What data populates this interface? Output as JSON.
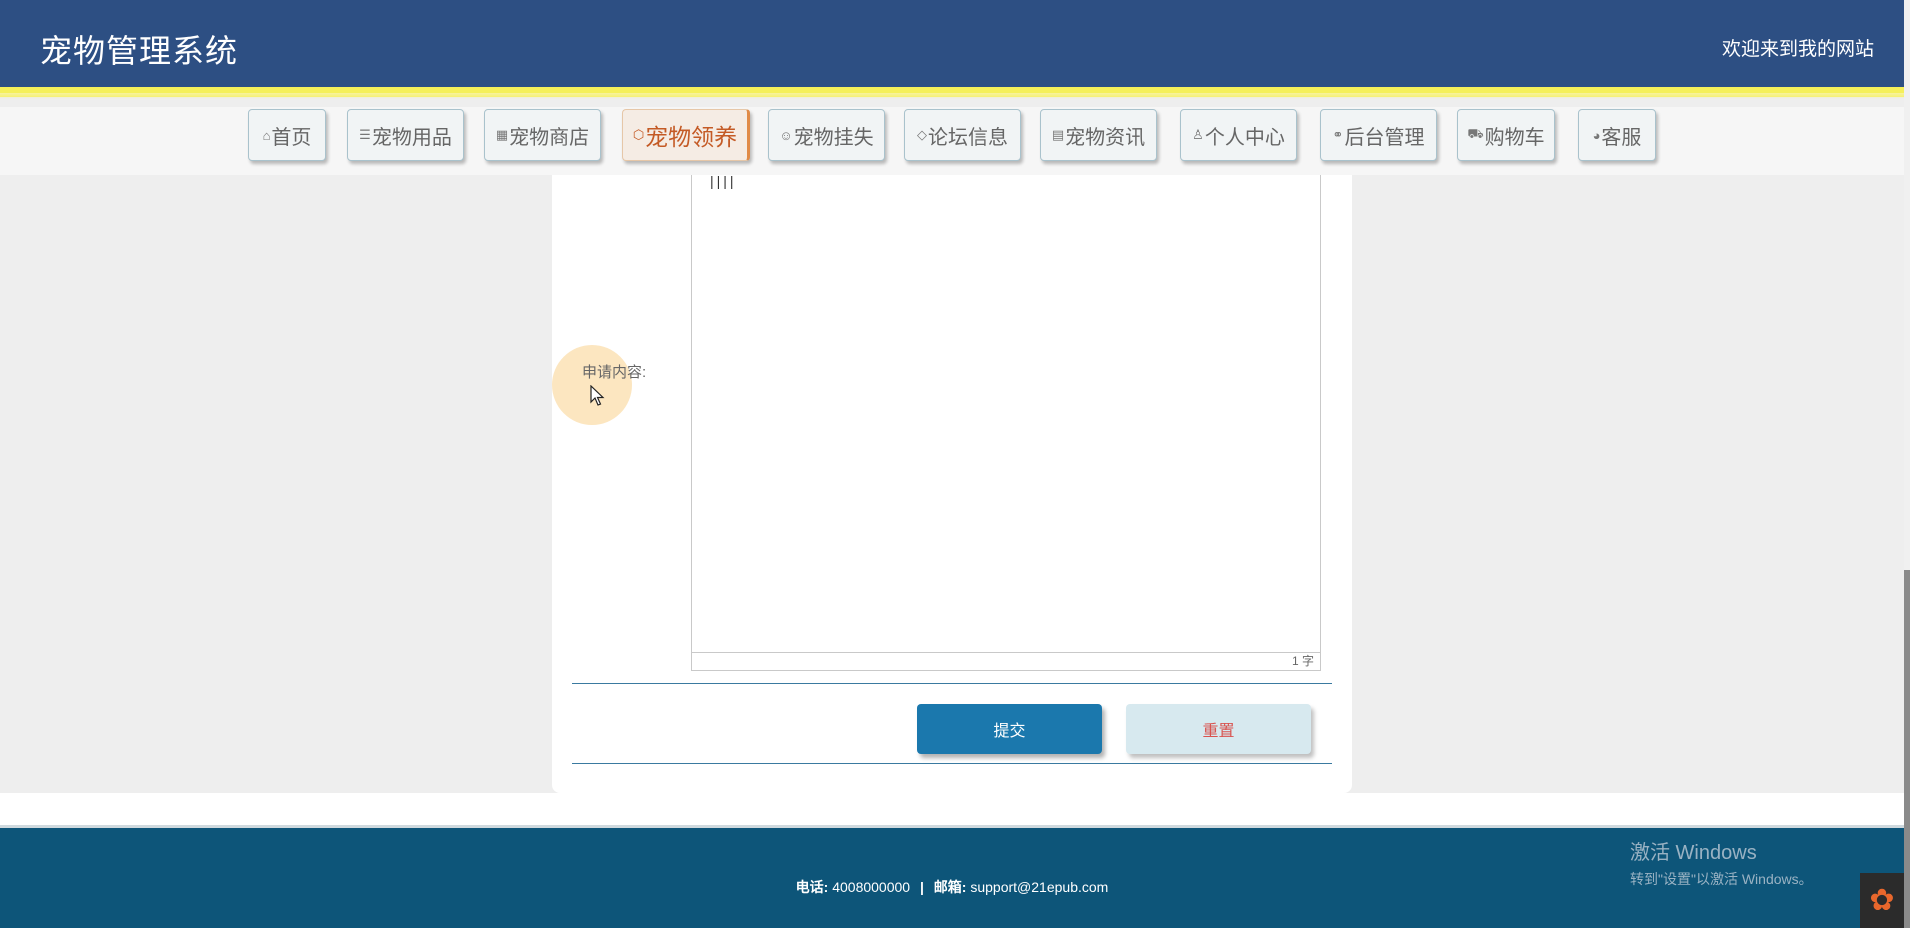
{
  "header": {
    "brand": "宠物管理系统",
    "welcome": "欢迎来到我的网站"
  },
  "nav": {
    "items": [
      {
        "label": "首页",
        "icon": "home-icon",
        "glyph": "⌂"
      },
      {
        "label": "宠物用品",
        "icon": "sliders-icon",
        "glyph": "☰"
      },
      {
        "label": "宠物商店",
        "icon": "store-icon",
        "glyph": "▦"
      },
      {
        "label": "宠物领养",
        "icon": "cube-icon",
        "glyph": "⬡",
        "active": true
      },
      {
        "label": "宠物挂失",
        "icon": "smile-icon",
        "glyph": "☺"
      },
      {
        "label": "论坛信息",
        "icon": "tag-icon",
        "glyph": "◇"
      },
      {
        "label": "宠物资讯",
        "icon": "document-icon",
        "glyph": "▤"
      },
      {
        "label": "个人中心",
        "icon": "user-icon",
        "glyph": "♙"
      },
      {
        "label": "后台管理",
        "icon": "link-icon",
        "glyph": "⚭"
      },
      {
        "label": "购物车",
        "icon": "cart-icon",
        "glyph": "⛟"
      },
      {
        "label": "客服",
        "icon": "chat-icon",
        "glyph": "◕"
      }
    ]
  },
  "form": {
    "content_label": "申请内容:",
    "editor_text": "||||",
    "word_count": "1 字",
    "submit_label": "提交",
    "reset_label": "重置"
  },
  "footer": {
    "phone_label": "电话:",
    "phone": "4008000000",
    "separator": "|",
    "email_label": "邮箱:",
    "email": "support@21epub.com"
  },
  "watermark": {
    "line1": "激活 Windows",
    "line2": "转到\"设置\"以激活 Windows。"
  },
  "colors": {
    "header_bg": "#2d4f83",
    "header_accent": "#f5f05a",
    "submit_bg": "#1b78ad",
    "reset_bg": "#d7e9ef",
    "footer_bg": "#0d5579",
    "active_nav": "#c45a25"
  }
}
